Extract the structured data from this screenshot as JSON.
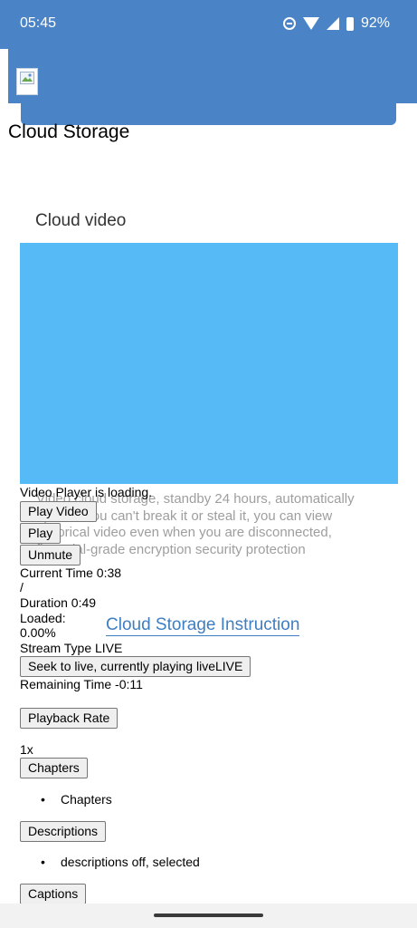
{
  "status": {
    "time": "05:45",
    "battery": "92%"
  },
  "page": {
    "title": "Cloud Storage",
    "section_title": "Cloud video"
  },
  "video": {
    "description": "Video cloud storage, standby 24 hours, automatically upload. You can't break it or steal it, you can view historical video even when you are disconnected, financial-grade encryption security protection",
    "instruction_link": "Cloud Storage Instruction"
  },
  "player": {
    "loading_text": "Video Player is loading.",
    "play_video_label": "Play Video",
    "play_label": "Play",
    "unmute_label": "Unmute",
    "current_time": "Current Time 0:38",
    "time_divider": "/",
    "duration": "Duration 0:49",
    "loaded_label": "Loaded:",
    "loaded_value": "0.00%",
    "stream_type": "Stream Type LIVE",
    "seek_live_label": "Seek to live, currently playing liveLIVE",
    "remaining_time": "Remaining Time -0:11",
    "playback_rate_label": "Playback Rate",
    "playback_rate_value": "1x",
    "chapters_label": "Chapters",
    "chapters_item": "Chapters",
    "descriptions_label": "Descriptions",
    "descriptions_item": "descriptions off, selected",
    "captions_label": "Captions"
  },
  "colors": {
    "header": "#4a84c6",
    "video": "#56baf7",
    "link": "#3f7ec1"
  }
}
